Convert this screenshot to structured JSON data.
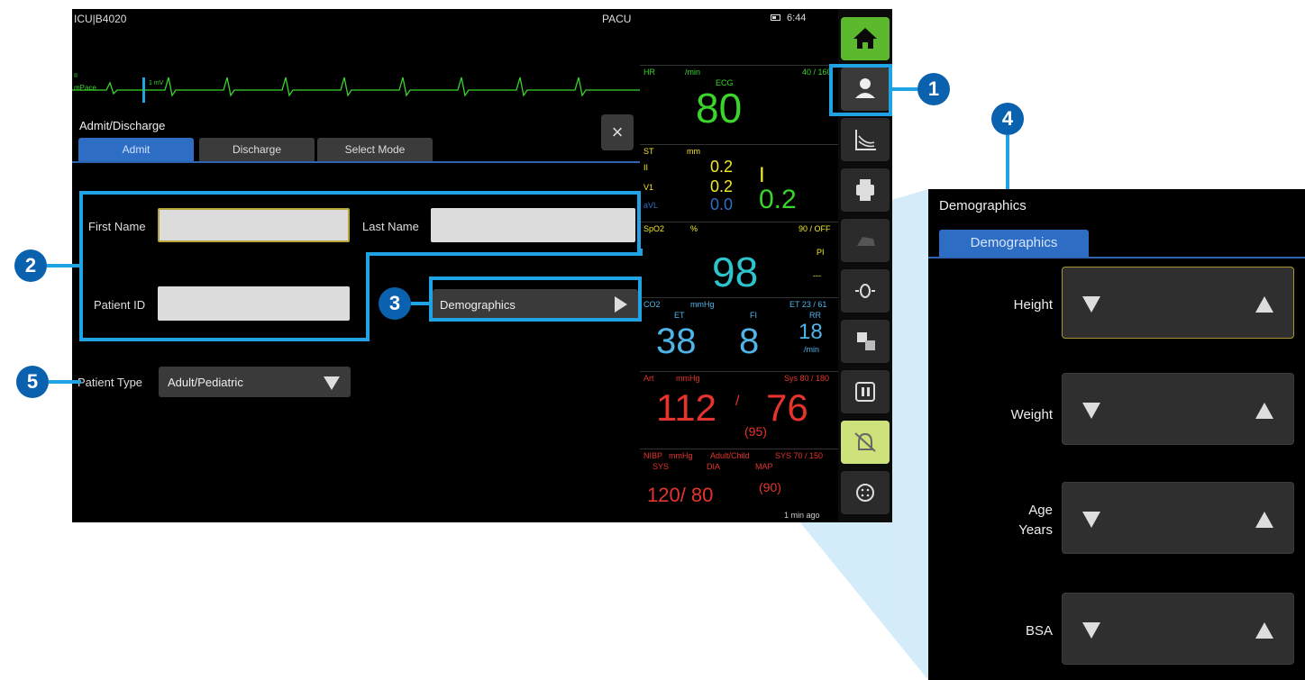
{
  "header": {
    "location": "ICU|B4020",
    "care_area": "PACU",
    "time": "6:44"
  },
  "ecg": {
    "lead": "II",
    "scale": "1 mV",
    "sub": "mPace"
  },
  "dialog": {
    "title": "Admit/Discharge",
    "close_icon": "×",
    "tabs": [
      "Admit",
      "Discharge",
      "Select Mode"
    ],
    "first_name_label": "First Name",
    "last_name_label": "Last Name",
    "patient_id_label": "Patient ID",
    "demographics_button": "Demographics",
    "patient_type_label": "Patient Type",
    "patient_type_value": "Adult/Pediatric"
  },
  "vitals": {
    "hr": {
      "label": "HR",
      "unit": "/min",
      "limits": "40 / 160",
      "source": "ECG",
      "value": "80"
    },
    "st": {
      "label": "ST",
      "unit": "mm",
      "leads": [
        "II",
        "V1",
        "aVL"
      ],
      "values": [
        "0.2",
        "0.2",
        "0.0"
      ],
      "lead_III": "I",
      "big": "0.2"
    },
    "spo2": {
      "label": "SpO2",
      "unit": "%",
      "limits": "90 / OFF",
      "pi_label": "PI",
      "pi_value": "---",
      "value": "98"
    },
    "co2": {
      "label": "CO2",
      "unit": "mmHg",
      "limits": "ET 23 / 61",
      "et_label": "ET",
      "fi_label": "FI",
      "rr_label": "RR",
      "et": "38",
      "fi": "8",
      "rr": "18",
      "rr_unit": "/min"
    },
    "art": {
      "label": "Art",
      "unit": "mmHg",
      "limits": "Sys 80 / 180",
      "sys": "112",
      "sep": "/",
      "dia": "76",
      "mean": "(95)"
    },
    "nibp": {
      "label": "NIBP",
      "unit": "mmHg",
      "mode": "Adult/Child",
      "limits": "SYS 70 / 150",
      "sys_label": "SYS",
      "dia_label": "DIA",
      "map_label": "MAP",
      "value": "120/ 80",
      "map": "(90)",
      "time": "1 min ago"
    }
  },
  "sidebar": [
    "home-icon",
    "patient-icon",
    "trends-icon",
    "printer-icon",
    "hand-icon",
    "zero-icon",
    "calculations-icon",
    "pause-icon",
    "alarm-silence-icon",
    "menu-icon"
  ],
  "callouts": [
    "1",
    "2",
    "3",
    "4",
    "5"
  ],
  "zoom": {
    "title": "Demographics",
    "tab": "Demographics",
    "rows": [
      "Height",
      "Weight",
      "Age Years",
      "BSA"
    ]
  },
  "colors": {
    "highlight": "#1fa3e4",
    "badge": "#0a61ad",
    "tab_active": "#2d6ec4",
    "hr": "#39d52b",
    "st": "#f3e82a",
    "spo2": "#2ec4ce",
    "co2": "#4fb4e8",
    "art": "#e5342d"
  }
}
